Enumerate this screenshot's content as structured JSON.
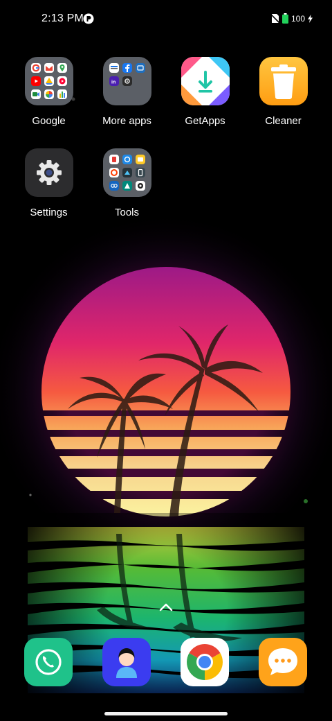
{
  "status_bar": {
    "time": "2:13 PM",
    "battery_text": "100",
    "icons": [
      "notification-app-icon",
      "no-sim-icon",
      "battery-icon",
      "charging-bolt-icon"
    ]
  },
  "apps": [
    {
      "label": "Google",
      "icon": "google-folder-icon"
    },
    {
      "label": "More apps",
      "icon": "more-apps-folder-icon"
    },
    {
      "label": "GetApps",
      "icon": "getapps-icon"
    },
    {
      "label": "Cleaner",
      "icon": "trash-icon"
    },
    {
      "label": "Settings",
      "icon": "gear-icon"
    },
    {
      "label": "Tools",
      "icon": "tools-folder-icon"
    }
  ],
  "dock": [
    {
      "name": "phone",
      "icon": "phone-icon",
      "color": "#1fc28a"
    },
    {
      "name": "contacts",
      "icon": "contacts-icon",
      "color": "#3b3cf0"
    },
    {
      "name": "chrome",
      "icon": "chrome-icon",
      "color": "#ffffff"
    },
    {
      "name": "messages",
      "icon": "messages-icon",
      "color": "#ffa31a"
    }
  ],
  "wallpaper": {
    "description": "synthwave sunset with palm trees and water reflection",
    "sun_top": "#b21b8c",
    "sun_bottom": "#fff6a6"
  }
}
